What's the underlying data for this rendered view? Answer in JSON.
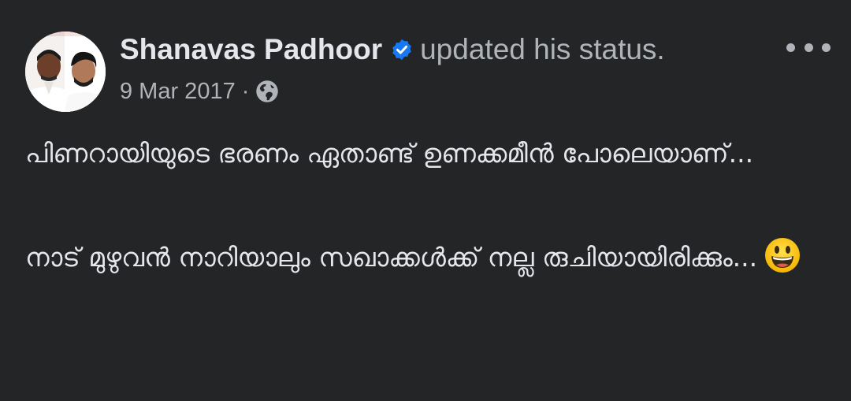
{
  "post": {
    "author": "Shanavas Padhoor",
    "action": "updated his status.",
    "date": "9 Mar 2017",
    "separator": "·",
    "privacy_icon": "globe-icon",
    "verified_icon": "verified-badge-icon",
    "more_icon": "more-horizontal-icon",
    "paragraphs": [
      "പിണറായിയുടെ ഭരണം ഏതാണ്ട് ഉണക്കമീൻ പോലെയാണ്...",
      "നാട് മുഴുവൻ നാറിയാലും സഖാക്കൾക്ക് നല്ല രുചിയായിരിക്കും..."
    ],
    "emoji": "grinning-face-emoji"
  },
  "colors": {
    "background": "#242526",
    "primary_text": "#e4e6eb",
    "secondary_text": "#b0b3b8",
    "verified_blue": "#1877f2"
  }
}
